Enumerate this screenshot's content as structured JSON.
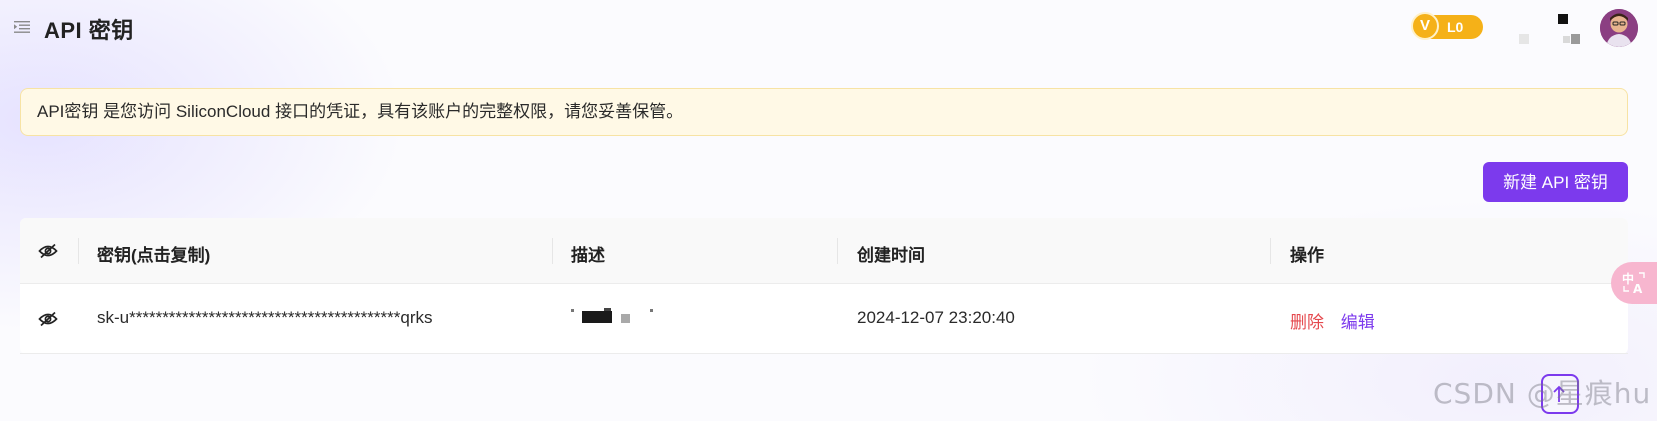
{
  "header": {
    "title": "API 密钥",
    "menu_icon": "menu-collapse-icon",
    "vip": {
      "badge_letter": "V",
      "level": "L0",
      "color": "#f5b118"
    },
    "avatar_icon": "user-avatar"
  },
  "notice": {
    "text": "API密钥 是您访问 SiliconCloud 接口的凭证，具有该账户的完整权限，请您妥善保管。",
    "background": "#fff9e6"
  },
  "toolbar": {
    "new_key_label": "新建 API 密钥",
    "accent": "#7c3aed"
  },
  "table": {
    "columns": {
      "visibility_icon": "eye-off-icon",
      "key": "密钥(点击复制)",
      "description": "描述",
      "created_at": "创建时间",
      "actions": "操作"
    },
    "rows": [
      {
        "visibility_icon": "eye-off-icon",
        "key": "sk-u*****************************************qrks",
        "description": "",
        "created_at": "2024-12-07 23:20:40",
        "actions": {
          "delete_label": "删除",
          "edit_label": "编辑"
        }
      }
    ]
  },
  "floating": {
    "translate_icon": "translate-icon",
    "back_to_top_icon": "back-to-top-icon"
  },
  "watermark": {
    "text": "CSDN @星痕hu"
  },
  "colors": {
    "accent": "#7c3aed",
    "danger": "#e5484d",
    "vip": "#f5b118"
  }
}
